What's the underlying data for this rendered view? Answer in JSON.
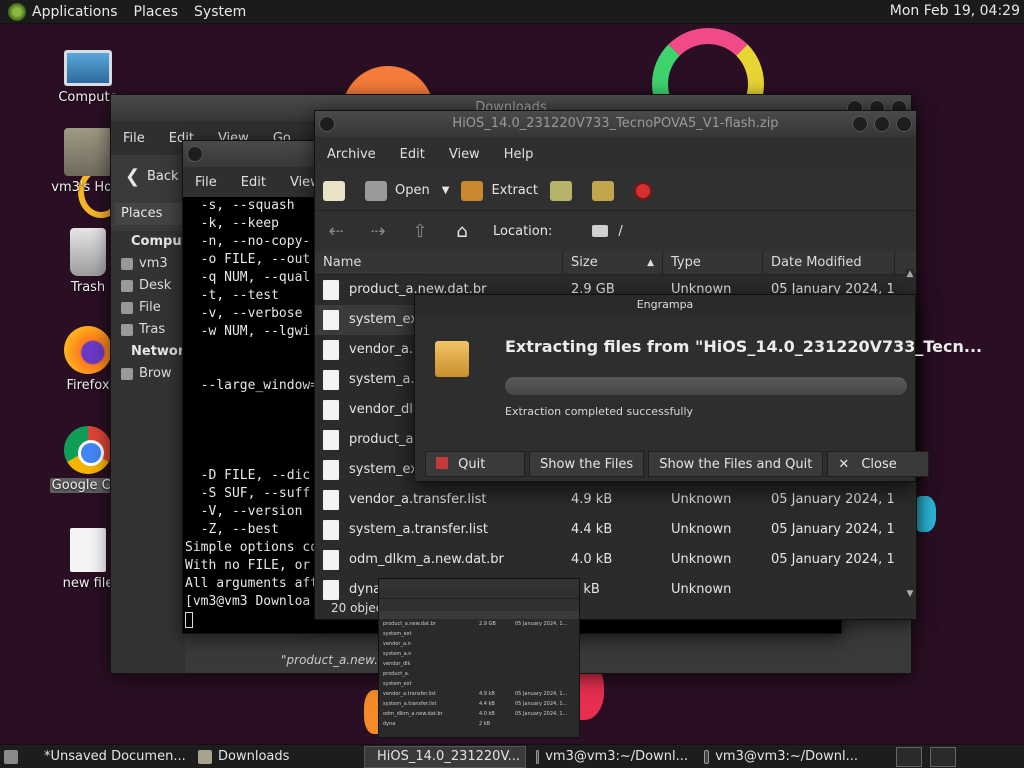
{
  "top_panel": {
    "menus": [
      "Applications",
      "Places",
      "System"
    ],
    "clock": "Mon Feb 19, 04:29"
  },
  "desktop_icons": [
    {
      "label": "Compute",
      "icon": "computer-icon"
    },
    {
      "label": "vm3's Hom",
      "icon": "home-folder-icon"
    },
    {
      "label": "Trash",
      "icon": "trash-icon"
    },
    {
      "label": "Firefox",
      "icon": "firefox-icon"
    },
    {
      "label": "Google Chr",
      "icon": "chrome-icon"
    },
    {
      "label": "new file",
      "icon": "file-icon"
    }
  ],
  "downloads_window": {
    "title": "Downloads",
    "menus": [
      "File",
      "Edit",
      "View",
      "Go",
      "Bo"
    ],
    "back_label": "Back",
    "places_label": "Places",
    "sidebar": {
      "computer_heading": "Computer",
      "computer_items": [
        "vm3",
        "Desk",
        "File",
        "Tras"
      ],
      "network_heading": "Network",
      "network_items": [
        "Brow"
      ]
    },
    "status": "\"product_a.new.dat"
  },
  "terminal_window": {
    "menus": [
      "File",
      "Edit",
      "View"
    ],
    "lines": [
      "  -s, --squash",
      "  -k, --keep",
      "  -n, --no-copy-",
      "  -o FILE, --out",
      "  -q NUM, --qual",
      "  -t, --test",
      "  -v, --verbose",
      "  -w NUM, --lgwi",
      "",
      "",
      "  --large_window=",
      "",
      "",
      "",
      "",
      "  -D FILE, --dic",
      "  -S SUF, --suff",
      "  -V, --version",
      "  -Z, --best",
      "Simple options co",
      "With no FILE, or",
      "All arguments aft",
      "[vm3@vm3 Downloa"
    ]
  },
  "archive_window": {
    "title": "HiOS_14.0_231220V733_TecnoPOVA5_V1-flash.zip",
    "menus": [
      "Archive",
      "Edit",
      "View",
      "Help"
    ],
    "toolbar": {
      "open": "Open",
      "extract": "Extract"
    },
    "location_label": "Location:",
    "location_value": "/",
    "columns": [
      "Name",
      "Size",
      "Type",
      "Date Modified"
    ],
    "rows": [
      {
        "name": "product_a.new.dat.br",
        "size": "2.9 GB",
        "type": "Unknown",
        "date": "05 January 2024, 1..."
      },
      {
        "name": "system_ext",
        "size": "",
        "type": "",
        "date": ""
      },
      {
        "name": "vendor_a.n",
        "size": "",
        "type": "",
        "date": ""
      },
      {
        "name": "system_a.n",
        "size": "",
        "type": "",
        "date": ""
      },
      {
        "name": "vendor_dlk",
        "size": "",
        "type": "",
        "date": ""
      },
      {
        "name": "product_a.",
        "size": "",
        "type": "",
        "date": ""
      },
      {
        "name": "system_ext",
        "size": "",
        "type": "",
        "date": ""
      },
      {
        "name": "vendor_a.transfer.list",
        "size": "4.9 kB",
        "type": "Unknown",
        "date": "05 January 2024, 1..."
      },
      {
        "name": "system_a.transfer.list",
        "size": "4.4 kB",
        "type": "Unknown",
        "date": "05 January 2024, 1..."
      },
      {
        "name": "odm_dlkm_a.new.dat.br",
        "size": "4.0 kB",
        "type": "Unknown",
        "date": "05 January 2024, 1..."
      },
      {
        "name": "dyna",
        "size": "2 kB",
        "type": "Unknown",
        "date": ""
      }
    ],
    "status": "20 objects"
  },
  "progress_dialog": {
    "title": "Engrampa",
    "heading": "Extracting files from \"HiOS_14.0_231220V733_Tecn...",
    "message": "Extraction completed successfully",
    "progress_fraction": 1.0,
    "buttons": {
      "quit": "Quit",
      "show_files": "Show the Files",
      "show_and_quit": "Show the Files and Quit",
      "close": "Close"
    }
  },
  "taskbar": {
    "items": [
      {
        "label": "*Unsaved Documen...",
        "active": false
      },
      {
        "label": "Downloads",
        "active": false
      },
      {
        "label": "HiOS_14.0_231220V...",
        "active": true
      },
      {
        "label": "vm3@vm3:~/Downl...",
        "active": false
      },
      {
        "label": "vm3@vm3:~/Downl...",
        "active": false
      }
    ]
  },
  "colors": {
    "desktop_bg": "#2a0f24",
    "panel_bg": "#1b1b1b",
    "window_bg": "#2e2e2e",
    "stop_red": "#d32f2f"
  }
}
